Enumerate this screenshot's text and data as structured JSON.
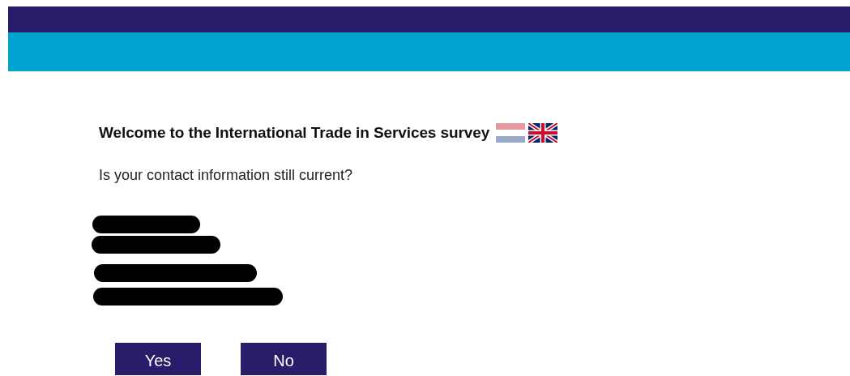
{
  "header": {
    "bands": [
      {
        "kind": "dark"
      },
      {
        "kind": "cyan"
      }
    ]
  },
  "title": "Welcome to the International Trade in Services survey",
  "languages": [
    {
      "kind": "nl",
      "selected": false
    },
    {
      "kind": "uk",
      "selected": true
    }
  ],
  "question": "Is your contact information still current?",
  "contact_lines": [
    {
      "redacted": true
    },
    {
      "redacted": true
    },
    {
      "redacted": true
    },
    {
      "redacted": true
    }
  ],
  "buttons": [
    "Yes",
    "No"
  ]
}
